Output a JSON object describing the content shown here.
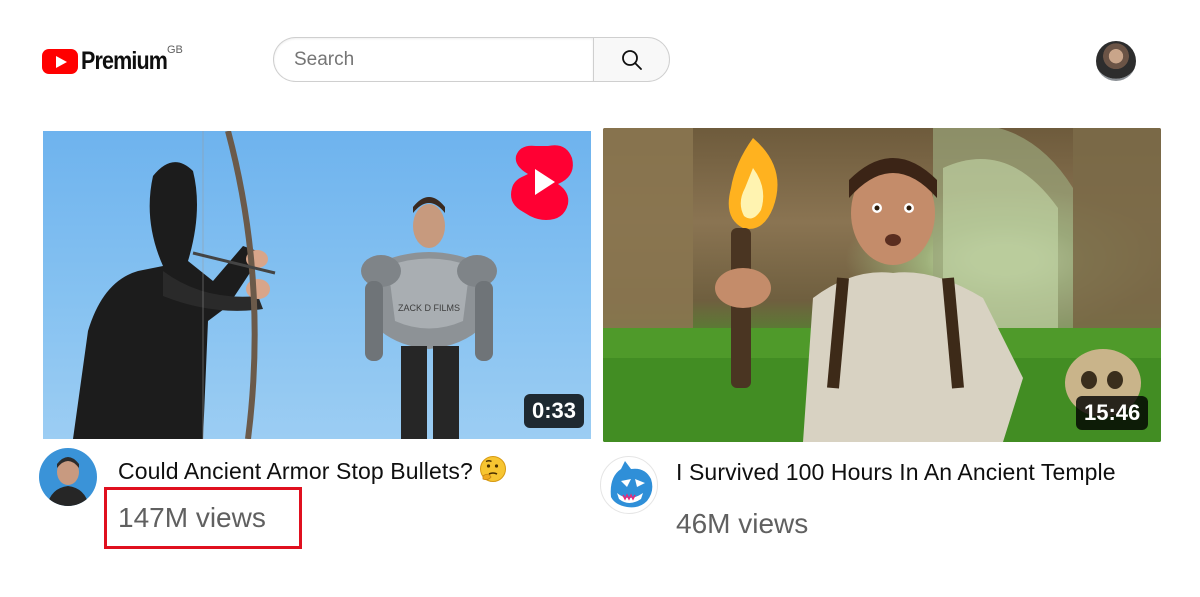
{
  "header": {
    "logo_text": "Premium",
    "logo_region": "GB",
    "search": {
      "placeholder": "Search",
      "value": ""
    }
  },
  "videos": [
    {
      "title": "Could Ancient Armor Stop Bullets?",
      "title_emoji": "thinking-face",
      "views": "147M views",
      "duration": "0:33",
      "badge": "shorts-icon",
      "thumbnail_text": "ZACK D FILMS",
      "highlighted": true
    },
    {
      "title": "I Survived 100 Hours In An Ancient Temple",
      "views": "46M views",
      "duration": "15:46"
    }
  ],
  "colors": {
    "brand_red": "#ff0000",
    "highlight_box": "#e0101f",
    "secondary_text": "#606060"
  }
}
